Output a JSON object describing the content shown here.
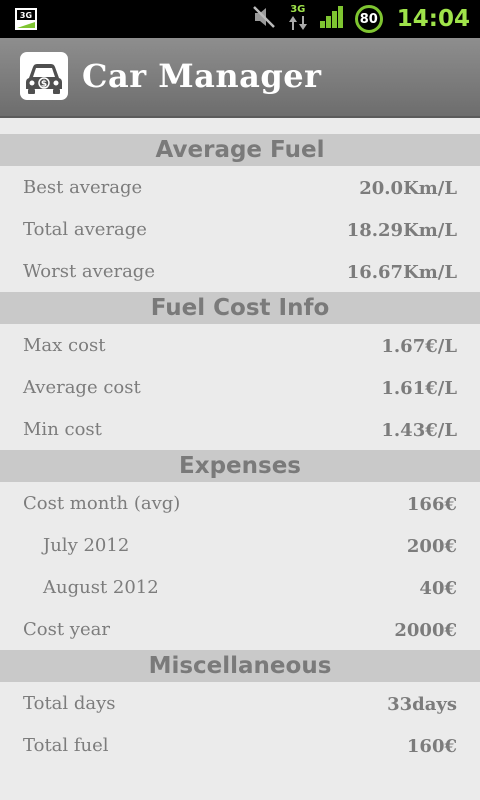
{
  "statusbar": {
    "time": "14:04",
    "battery": "80",
    "network": "3G",
    "sim_badge": "3G"
  },
  "appbar": {
    "title": "Car Manager"
  },
  "sections": {
    "average_fuel": {
      "title": "Average Fuel",
      "rows": [
        {
          "label": "Best average",
          "value": "20.0Km/L"
        },
        {
          "label": "Total average",
          "value": "18.29Km/L"
        },
        {
          "label": "Worst average",
          "value": "16.67Km/L"
        }
      ]
    },
    "fuel_cost": {
      "title": "Fuel Cost Info",
      "rows": [
        {
          "label": "Max cost",
          "value": "1.67€/L"
        },
        {
          "label": "Average cost",
          "value": "1.61€/L"
        },
        {
          "label": "Min cost",
          "value": "1.43€/L"
        }
      ]
    },
    "expenses": {
      "title": "Expenses",
      "rows": [
        {
          "label": "Cost month (avg)",
          "value": "166€"
        },
        {
          "label": "July 2012",
          "value": "200€"
        },
        {
          "label": "August 2012",
          "value": "40€"
        },
        {
          "label": "Cost year",
          "value": "2000€"
        }
      ]
    },
    "misc": {
      "title": "Miscellaneous",
      "rows": [
        {
          "label": "Total days",
          "value": "33days"
        },
        {
          "label": "Total fuel",
          "value": "160€"
        }
      ]
    }
  }
}
